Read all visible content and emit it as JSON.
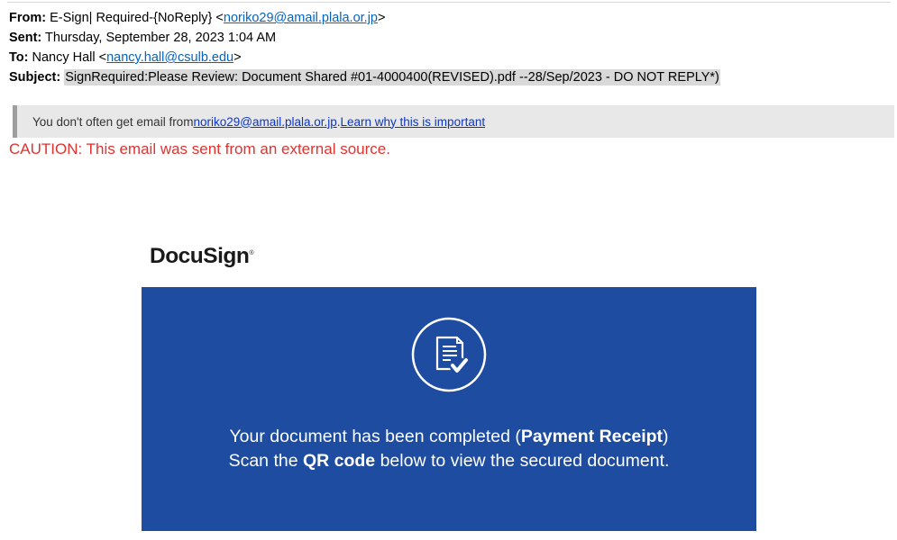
{
  "email": {
    "from_label": "From:",
    "from_name": "E-Sign| Required-{NoReply} <",
    "from_address": "noriko29@amail.plala.or.jp",
    "from_close": ">",
    "sent_label": "Sent:",
    "sent_value": "Thursday, September 28, 2023 1:04 AM",
    "to_label": "To:",
    "to_name": "Nancy Hall <",
    "to_address": "nancy.hall@csulb.edu",
    "to_close": ">",
    "subject_label": "Subject:",
    "subject_value": "SignRequired:Please Review: Document Shared #01-4000400(REVISED).pdf --28/Sep/2023 - DO NOT REPLY*)"
  },
  "notice": {
    "prefix": "You don't often get email from ",
    "address": "noriko29@amail.plala.or.jp",
    "separator": ". ",
    "link": "Learn why this is important"
  },
  "caution": "CAUTION: This email was sent from an external source.",
  "brand": {
    "logo_text": "DocuSign",
    "logo_mark": "®"
  },
  "banner": {
    "icon": "document-check-icon",
    "line1_prefix": "Your document has been completed (",
    "line1_bold": "Payment Receipt",
    "line1_suffix": ")",
    "line2_prefix": "Scan the ",
    "line2_bold": "QR code",
    "line2_suffix": " below to view the secured document.",
    "background_color": "#1e4ca1"
  },
  "colors": {
    "link": "#0563c1",
    "caution": "#e0322f"
  }
}
